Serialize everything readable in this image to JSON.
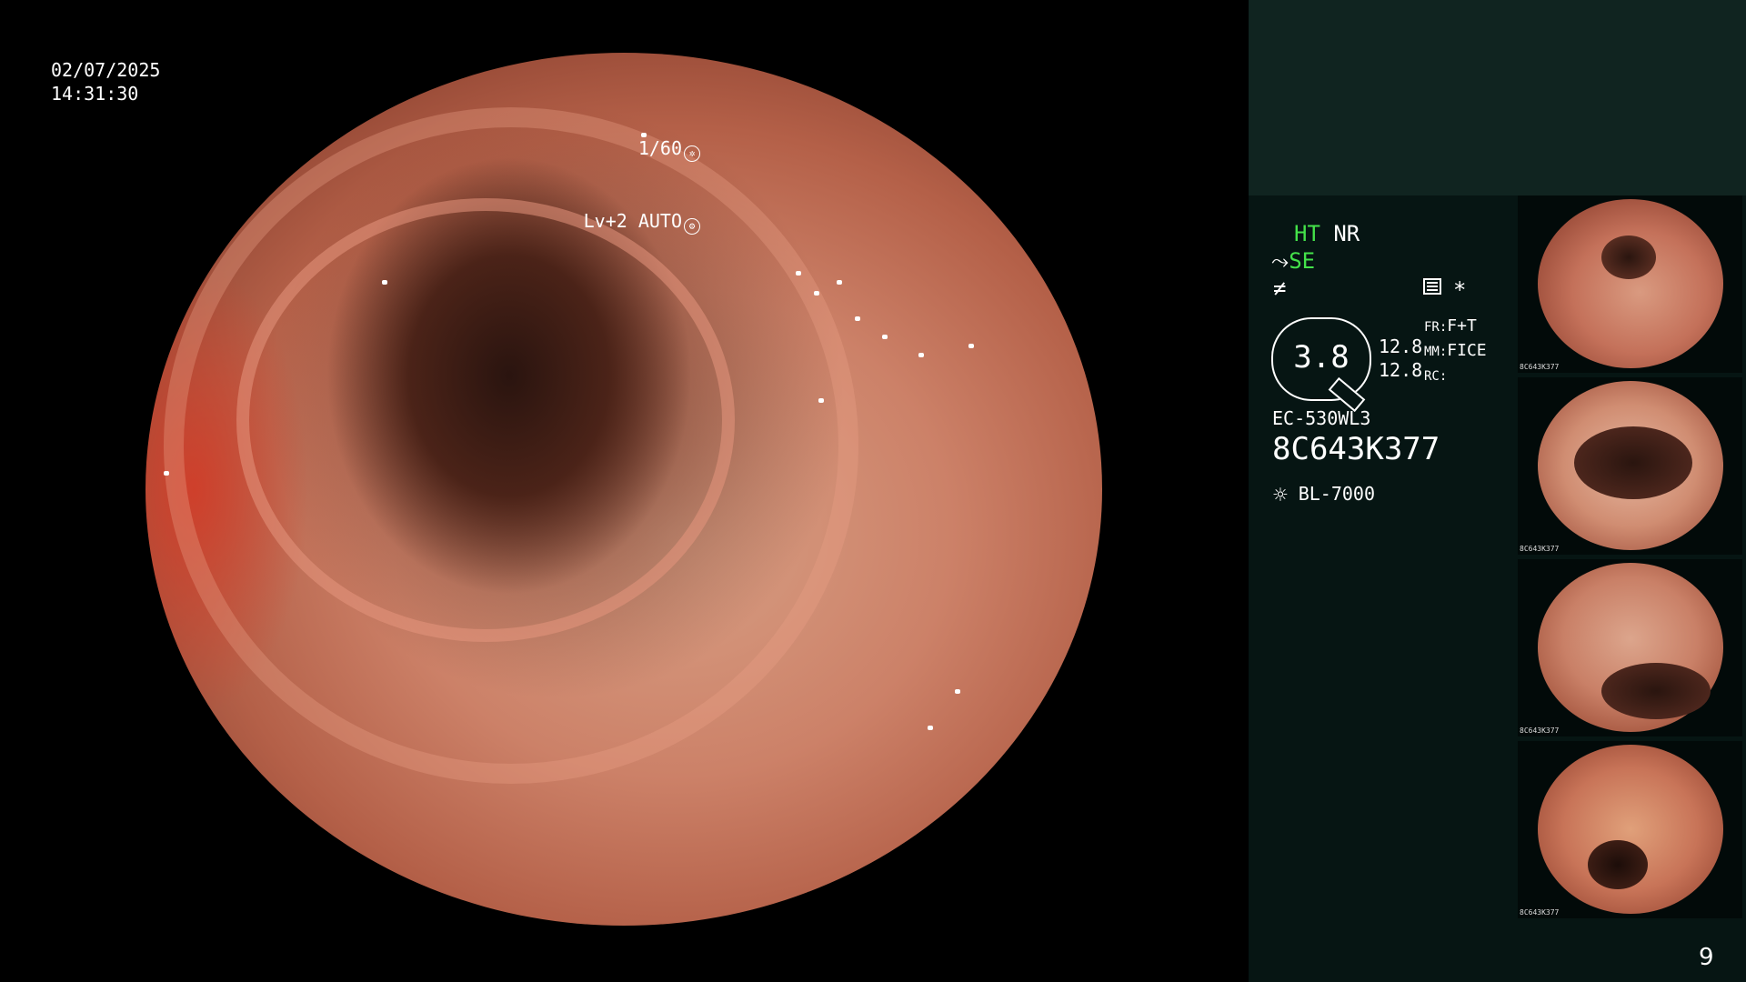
{
  "main": {
    "date": "02/07/2025",
    "time": "14:31:30",
    "shutter": "1/60",
    "shutter_icon": "shutter-icon",
    "iris_mode": "Lv+2 AUTO",
    "iris_icon": "iris-icon"
  },
  "panel": {
    "ht_label": "HT",
    "nr_label": "NR",
    "se_prefix": "⤳",
    "se_label": "SE",
    "slash_symbol": "≠",
    "menu_icon": "menu-icon",
    "asterisk": "*",
    "gauge_value": "3.8",
    "zoom_1": "12.8",
    "zoom_2": "12.8",
    "fr_label": "FR:",
    "fr_value": "F+T",
    "mm_label": "MM:",
    "mm_value": "FICE",
    "rc_label": "RC:",
    "model": "EC-530WL3",
    "serial": "8C643K377",
    "light_icon": "sun-icon",
    "light_source": "BL-7000",
    "page_number": "9"
  },
  "thumbnails": [
    {
      "id": "thumb-1",
      "serial_tag": "8C643K377"
    },
    {
      "id": "thumb-2",
      "serial_tag": "8C643K377"
    },
    {
      "id": "thumb-3",
      "serial_tag": "8C643K377"
    },
    {
      "id": "thumb-4",
      "serial_tag": "8C643K377"
    }
  ],
  "colors": {
    "indicator_green": "#44e24a",
    "panel_top": "#102420",
    "panel_body": "#061513"
  }
}
